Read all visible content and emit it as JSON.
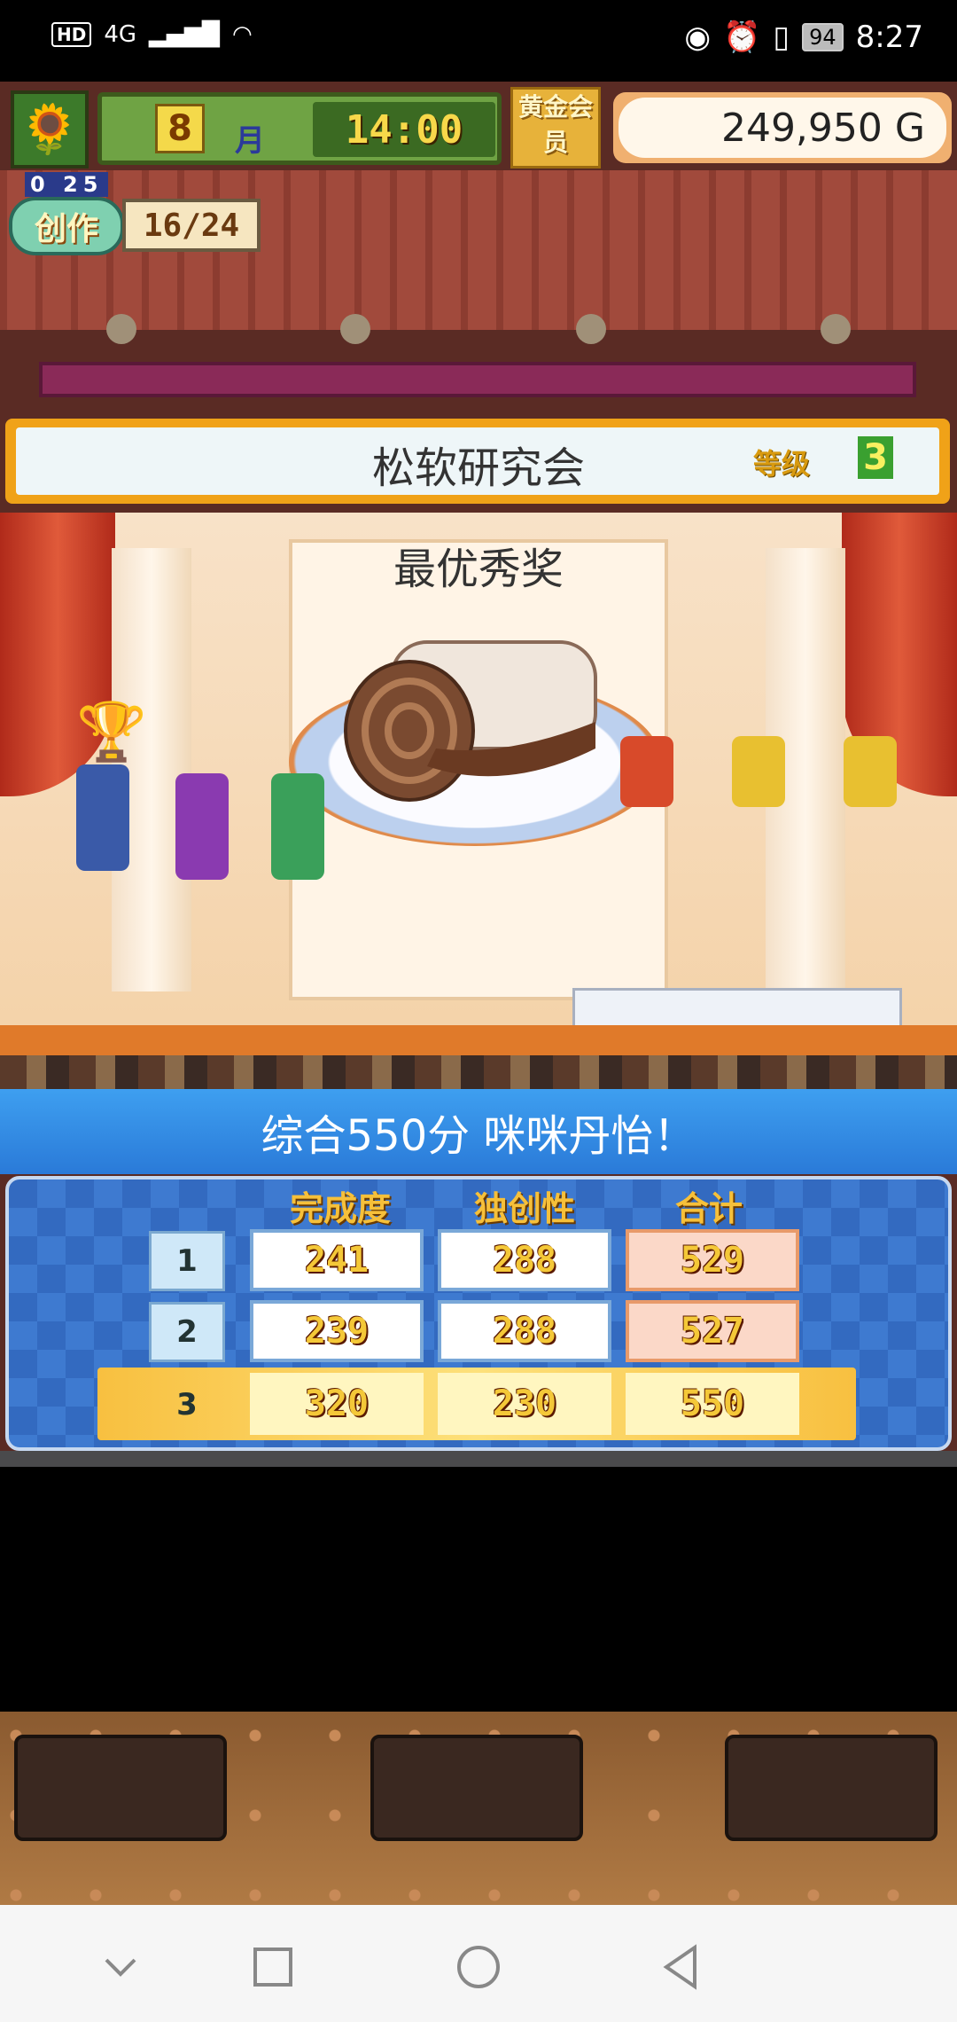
{
  "status_bar": {
    "network": "HD",
    "signal": "4G",
    "battery": "94",
    "time": "8:27"
  },
  "hud": {
    "month_number": "8",
    "month_unit": "月",
    "time": "14:00",
    "gold_badge": "黄金会员",
    "money": "249,950 G",
    "create_label": "创作",
    "create_sub": "0 25",
    "create_count": "16/24"
  },
  "banner": {
    "title": "松软研究会",
    "rank_label": "等级",
    "rank_value": "3"
  },
  "award": {
    "title": "最优秀奖"
  },
  "result": {
    "headline": "综合550分 咪咪丹怡！",
    "columns": [
      "完成度",
      "独创性",
      "合计"
    ],
    "rows": [
      {
        "rank": "1",
        "completion": "241",
        "originality": "288",
        "total": "529"
      },
      {
        "rank": "2",
        "completion": "239",
        "originality": "288",
        "total": "527"
      },
      {
        "rank": "3",
        "completion": "320",
        "originality": "230",
        "total": "550"
      }
    ]
  },
  "colors": {
    "accent_blue": "#2a7ad8",
    "gold": "#f0a218"
  },
  "icons": [
    "sunflower-icon",
    "trophy-icon",
    "nav-back-icon",
    "nav-home-icon",
    "nav-recents-icon",
    "nav-down-icon"
  ]
}
